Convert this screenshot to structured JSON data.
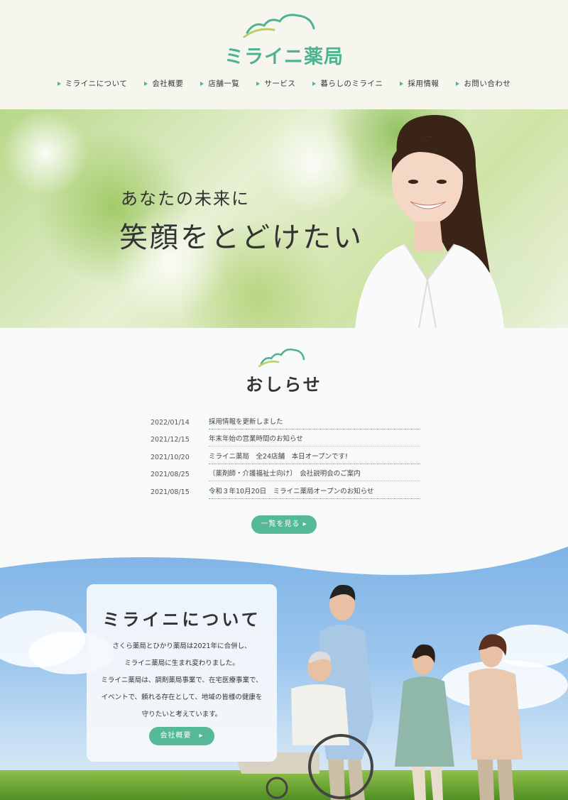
{
  "brand": {
    "name": "ミライニ薬局",
    "color": "#4fb392"
  },
  "nav": [
    {
      "label": "ミライニについて"
    },
    {
      "label": "会社概要"
    },
    {
      "label": "店舗一覧"
    },
    {
      "label": "サービス"
    },
    {
      "label": "暮らしのミライニ"
    },
    {
      "label": "採用情報"
    },
    {
      "label": "お問い合わせ"
    }
  ],
  "hero": {
    "line1": "あなたの未来に",
    "line2": "笑顔をとどけたい"
  },
  "news": {
    "title": "おしらせ",
    "items": [
      {
        "date": "2022/01/14",
        "text": "採用情報を更新しました"
      },
      {
        "date": "2021/12/15",
        "text": "年末年始の営業時間のお知らせ"
      },
      {
        "date": "2021/10/20",
        "text": "ミライニ薬局　全24店舗　本日オープンです!"
      },
      {
        "date": "2021/08/25",
        "text": "〔薬剤師・介護福祉士向け〕　会社説明会のご案内"
      },
      {
        "date": "2021/08/15",
        "text": "令和３年10月20日　ミライニ薬局オープンのお知らせ"
      }
    ],
    "more_button": "一覧を見る ▸"
  },
  "about": {
    "title": "ミライニについて",
    "lines": [
      "さくら薬局とひかり薬局は2021年に合併し、",
      "ミライニ薬局に生まれ変わりました。",
      "ミライニ薬局は、調剤薬局事業で、在宅医療事業で、",
      "イベントで、頼れる存在として、地域の皆様の健康を",
      "守りたいと考えています。"
    ],
    "button": "会社概要　▸"
  }
}
